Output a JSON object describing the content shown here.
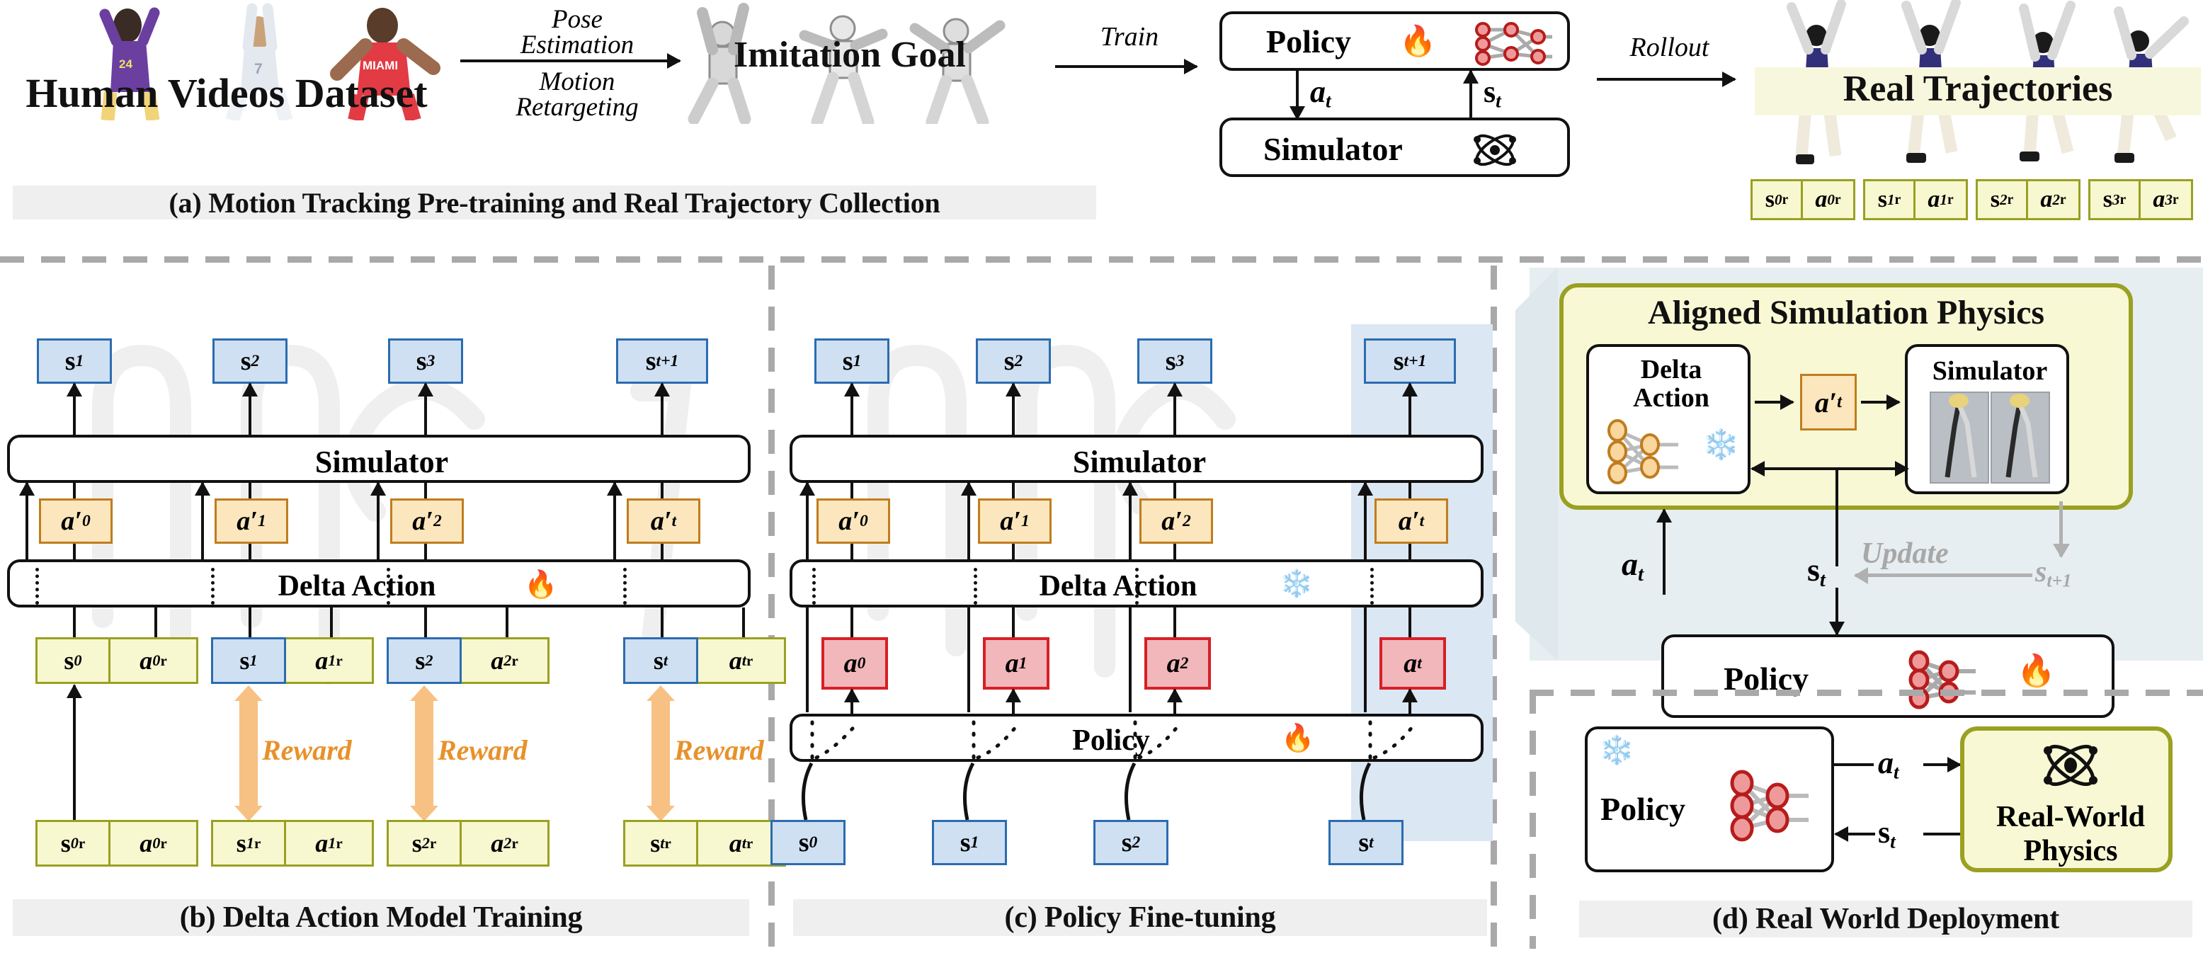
{
  "figure": {
    "title": "Humanoid policy training pipeline with delta action model"
  },
  "colors": {
    "state_fill": "#cfe0f3",
    "state_stroke": "#2b6cb0",
    "action_fill": "#fce6bd",
    "action_stroke": "#c07d1e",
    "policy_action_fill": "#f2b7bb",
    "policy_action_stroke": "#d81f26",
    "real_fill": "#f7f7d0",
    "real_stroke": "#9aa021",
    "reward": "#f7c183",
    "reward_text": "#e8912a",
    "caption_bg": "#efefef",
    "panel_tint": "#e6eef1",
    "highlight": "#f7f7dd"
  },
  "panel_a": {
    "caption": "(a) Motion Tracking Pre-training and Real Trajectory Collection",
    "dataset_label": "Human Videos Dataset",
    "arrow1_lines": [
      "Pose",
      "Estimation",
      "Motion",
      "Retargeting"
    ],
    "goal_label": "Imitation Goal",
    "arrow2_label": "Train",
    "policy_label": "Policy",
    "policy_icon": "fire-icon",
    "policy_net_icon": "neural-net-icon",
    "simulator_label": "Simulator",
    "simulator_icon": "atom-icon",
    "action_signal": "a",
    "action_signal_sub": "t",
    "state_signal": "s",
    "state_signal_sub": "t",
    "arrow3_label": "Rollout",
    "trajectories_label": "Real Trajectories",
    "traj_tokens": [
      {
        "sym": "s",
        "sub": "0",
        "sup": "r"
      },
      {
        "sym": "a",
        "sub": "0",
        "sup": "r"
      },
      {
        "sym": "s",
        "sub": "1",
        "sup": "r"
      },
      {
        "sym": "a",
        "sub": "1",
        "sup": "r"
      },
      {
        "sym": "s",
        "sub": "2",
        "sup": "r"
      },
      {
        "sym": "a",
        "sub": "2",
        "sup": "r"
      },
      {
        "sym": "s",
        "sub": "3",
        "sup": "r"
      },
      {
        "sym": "a",
        "sub": "3",
        "sup": "r"
      }
    ]
  },
  "panel_b": {
    "caption": "(b) Delta Action Model Training",
    "simulator_label": "Simulator",
    "delta_action_label": "Delta Action",
    "delta_action_icon": "fire-icon",
    "reward_label": "Reward",
    "sim_states": [
      {
        "sym": "s",
        "sub": "1"
      },
      {
        "sym": "s",
        "sub": "2"
      },
      {
        "sym": "s",
        "sub": "3"
      },
      {
        "sym": "s",
        "sub": "t+1"
      }
    ],
    "delta_actions": [
      {
        "sym": "a",
        "sub": "0",
        "prime": "′"
      },
      {
        "sym": "a",
        "sub": "1",
        "prime": "′"
      },
      {
        "sym": "a",
        "sub": "2",
        "prime": "′"
      },
      {
        "sym": "a",
        "sub": "t",
        "prime": "′"
      }
    ],
    "input_pairs": [
      {
        "state": {
          "sym": "s",
          "sub": "0",
          "sup": ""
        },
        "action": {
          "sym": "a",
          "sub": "0",
          "sup": "r"
        },
        "state_blue": false
      },
      {
        "state": {
          "sym": "s",
          "sub": "1",
          "sup": ""
        },
        "action": {
          "sym": "a",
          "sub": "1",
          "sup": "r"
        },
        "state_blue": true
      },
      {
        "state": {
          "sym": "s",
          "sub": "2",
          "sup": ""
        },
        "action": {
          "sym": "a",
          "sub": "2",
          "sup": "r"
        },
        "state_blue": true
      },
      {
        "state": {
          "sym": "s",
          "sub": "t",
          "sup": ""
        },
        "action": {
          "sym": "a",
          "sub": "t",
          "sup": "r"
        },
        "state_blue": true
      }
    ],
    "real_pairs": [
      {
        "state": {
          "sym": "s",
          "sub": "0",
          "sup": "r"
        },
        "action": {
          "sym": "a",
          "sub": "0",
          "sup": "r"
        }
      },
      {
        "state": {
          "sym": "s",
          "sub": "1",
          "sup": "r"
        },
        "action": {
          "sym": "a",
          "sub": "1",
          "sup": "r"
        }
      },
      {
        "state": {
          "sym": "s",
          "sub": "2",
          "sup": "r"
        },
        "action": {
          "sym": "a",
          "sub": "2",
          "sup": "r"
        }
      },
      {
        "state": {
          "sym": "s",
          "sub": "t",
          "sup": "r"
        },
        "action": {
          "sym": "a",
          "sub": "t",
          "sup": "r"
        }
      }
    ]
  },
  "panel_c": {
    "caption": "(c) Policy Fine-tuning",
    "simulator_label": "Simulator",
    "delta_action_label": "Delta Action",
    "delta_action_icon": "snowflake-icon",
    "policy_label": "Policy",
    "policy_icon": "fire-icon",
    "sim_states": [
      {
        "sym": "s",
        "sub": "1"
      },
      {
        "sym": "s",
        "sub": "2"
      },
      {
        "sym": "s",
        "sub": "3"
      },
      {
        "sym": "s",
        "sub": "t+1"
      }
    ],
    "delta_actions": [
      {
        "sym": "a",
        "sub": "0",
        "prime": "′"
      },
      {
        "sym": "a",
        "sub": "1",
        "prime": "′"
      },
      {
        "sym": "a",
        "sub": "2",
        "prime": "′"
      },
      {
        "sym": "a",
        "sub": "t",
        "prime": "′"
      }
    ],
    "policy_actions": [
      {
        "sym": "a",
        "sub": "0"
      },
      {
        "sym": "a",
        "sub": "1"
      },
      {
        "sym": "a",
        "sub": "2"
      },
      {
        "sym": "a",
        "sub": "t"
      }
    ],
    "policy_states": [
      {
        "sym": "s",
        "sub": "0"
      },
      {
        "sym": "s",
        "sub": "1"
      },
      {
        "sym": "s",
        "sub": "2"
      },
      {
        "sym": "s",
        "sub": "t"
      }
    ]
  },
  "panel_zoom": {
    "title": "Aligned Simulation Physics",
    "delta_action_label_l1": "Delta",
    "delta_action_label_l2": "Action",
    "delta_action_icon": "snowflake-icon",
    "delta_net_icon": "neural-net-icon",
    "mid_action": {
      "sym": "a",
      "sub": "t",
      "prime": "′"
    },
    "simulator_label": "Simulator",
    "simulator_thumb_icon": "robot-frames-icon",
    "policy_label": "Policy",
    "policy_icon": "fire-icon",
    "policy_net_icon": "neural-net-icon",
    "action_signal": {
      "sym": "a",
      "sub": "t"
    },
    "state_signal": {
      "sym": "s",
      "sub": "t"
    },
    "update_label": "Update",
    "next_state_signal": {
      "sym": "s",
      "sub": "t+1"
    }
  },
  "panel_d": {
    "caption": "(d) Real World Deployment",
    "policy_label": "Policy",
    "policy_icon": "snowflake-icon",
    "policy_net_icon": "neural-net-icon",
    "physics_label_l1": "Real-World",
    "physics_label_l2": "Physics",
    "physics_icon": "atom-icon",
    "action_signal": {
      "sym": "a",
      "sub": "t"
    },
    "state_signal": {
      "sym": "s",
      "sub": "t"
    }
  }
}
